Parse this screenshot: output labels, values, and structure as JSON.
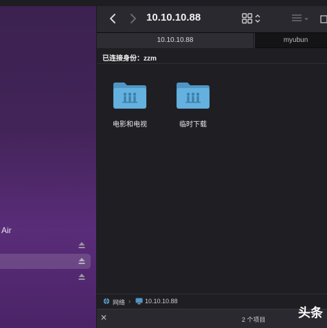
{
  "window": {
    "title": "10.10.10.88",
    "tabs": [
      {
        "label": "10.10.10.88",
        "active": true
      },
      {
        "label": "myubun",
        "active": false
      }
    ],
    "status_line": "已连接身份：zzm",
    "files": [
      {
        "name": "电影和电视",
        "icon": "shared-folder-icon"
      },
      {
        "name": "临时下载",
        "icon": "shared-folder-icon"
      }
    ],
    "path": {
      "network_label": "网络",
      "server_label": "10.10.10.88"
    },
    "item_count": "2 个项目"
  },
  "sidebar": {
    "device_label": "Air"
  },
  "watermark": "头条",
  "colors": {
    "folder": "#5aa7d6",
    "window_bg": "#1f1e23",
    "sidebar_bg": "#4a2467"
  }
}
